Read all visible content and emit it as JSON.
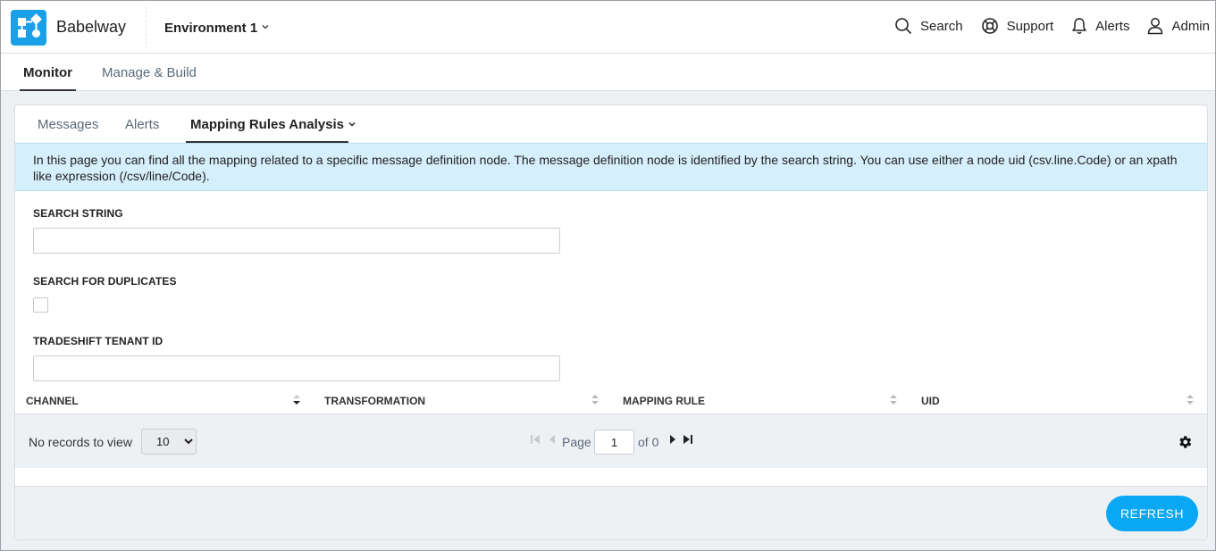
{
  "app": {
    "brand": "Babelway",
    "environment": "Environment 1",
    "brand_color": "#1aa0e8"
  },
  "top_actions": {
    "search": "Search",
    "support": "Support",
    "alerts": "Alerts",
    "admin": "Admin"
  },
  "main_tabs": {
    "monitor": "Monitor",
    "manage_build": "Manage & Build"
  },
  "sub_tabs": {
    "messages": "Messages",
    "alerts": "Alerts",
    "mapping_rules": "Mapping Rules Analysis"
  },
  "info_text": "In this page you can find all the mapping related to a specific message definition node. The message definition node is identified by the search string. You can use either a node uid (csv.line.Code) or an xpath like expression (/csv/line/Code).",
  "form": {
    "search_string_label": "SEARCH STRING",
    "search_string_value": "",
    "duplicates_label": "SEARCH FOR DUPLICATES",
    "duplicates_checked": false,
    "tenant_label": "TRADESHIFT TENANT ID",
    "tenant_value": ""
  },
  "grid": {
    "columns": [
      "CHANNEL",
      "TRANSFORMATION",
      "MAPPING RULE",
      "UID"
    ]
  },
  "pager": {
    "no_records": "No records to view",
    "page_size": "10",
    "page_size_options": [
      "10"
    ],
    "page_label": "Page",
    "page_value": "1",
    "of_label": "of 0"
  },
  "footer": {
    "refresh_label": "REFRESH",
    "accent_color": "#0aa7f5"
  }
}
